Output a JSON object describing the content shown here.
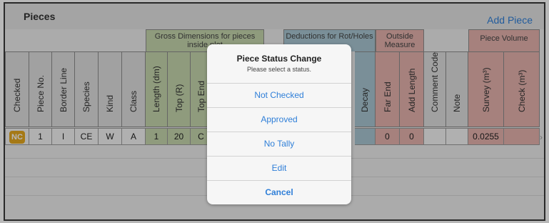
{
  "header": {
    "title": "Pieces",
    "add_label": "Add Piece"
  },
  "column_groups": {
    "gross": "Gross Dimensions for pieces inside plot",
    "deductions": "Deductions for Rot/Holes",
    "outside": "Outside Measure",
    "volume": "Piece Volume"
  },
  "columns": {
    "checked": "Checked",
    "piece_no": "Piece No.",
    "border_line": "Border Line",
    "species": "Species",
    "kind": "Kind",
    "class": "Class",
    "length": "Length (dm)",
    "top": "Top (R)",
    "top_end": "Top End",
    "decay": "Decay",
    "far_end": "Far End",
    "add_length": "Add Length",
    "comment_code": "Comment Code",
    "note": "Note",
    "survey": "Survey (m³)",
    "check": "Check (m³)"
  },
  "row": {
    "checked": "NC",
    "piece_no": "1",
    "border_line": "I",
    "species": "CE",
    "kind": "W",
    "class": "A",
    "length": "1",
    "top": "20",
    "top_end": "C",
    "decay": "",
    "far_end": "0",
    "add_length": "0",
    "comment_code": "",
    "note": "",
    "survey": "0.0255",
    "check": ""
  },
  "modal": {
    "title": "Piece Status Change",
    "subtitle": "Please select a status.",
    "options": [
      "Not Checked",
      "Approved",
      "No Tally",
      "Edit"
    ],
    "cancel": "Cancel"
  },
  "colors": {
    "accent": "#2f7fd8",
    "badge": "#e5a81f",
    "gross_group": "#c7d7ae",
    "deductions_group": "#a9c7d3",
    "outside_group": "#e6b3ae"
  }
}
